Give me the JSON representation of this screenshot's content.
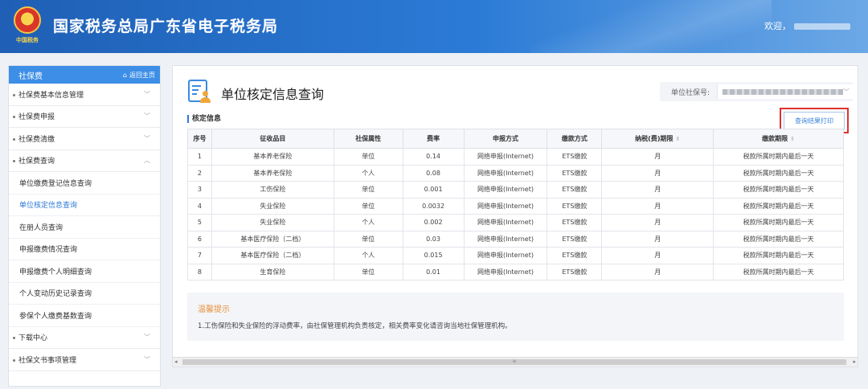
{
  "header": {
    "title": "国家税务总局广东省电子税务局",
    "emblem_caption": "中国税务",
    "welcome": "欢迎，"
  },
  "sidebar": {
    "title": "社保费",
    "home": "返回主页",
    "items": [
      {
        "label": "社保费基本信息管理"
      },
      {
        "label": "社保费申报"
      },
      {
        "label": "社保费清缴"
      },
      {
        "label": "社保费查询"
      }
    ],
    "subitems": [
      {
        "label": "单位缴费登记信息查询"
      },
      {
        "label": "单位核定信息查询"
      },
      {
        "label": "在册人员查询"
      },
      {
        "label": "申报缴费情况查询"
      },
      {
        "label": "申报缴费个人明细查询"
      },
      {
        "label": "个人变动历史记录查询"
      },
      {
        "label": "参保个人缴费基数查询"
      }
    ],
    "bottom_items": [
      {
        "label": "下载中心"
      },
      {
        "label": "社保文书事项管理"
      }
    ]
  },
  "main": {
    "page_title": "单位核定信息查询",
    "unit_label": "单位社保号:",
    "print_button": "查询结果打印",
    "section_title": "核定信息",
    "columns": [
      "序号",
      "征收品目",
      "社保属性",
      "费率",
      "申报方式",
      "缴款方式",
      "纳税(费)期限",
      "缴款期限"
    ],
    "rows": [
      [
        "1",
        "基本养老保险",
        "单位",
        "0.14",
        "网络申报(Internet)",
        "ETS缴款",
        "月",
        "税款所属时期内最后一天"
      ],
      [
        "2",
        "基本养老保险",
        "个人",
        "0.08",
        "网络申报(Internet)",
        "ETS缴款",
        "月",
        "税款所属时期内最后一天"
      ],
      [
        "3",
        "工伤保险",
        "单位",
        "0.001",
        "网络申报(Internet)",
        "ETS缴款",
        "月",
        "税款所属时期内最后一天"
      ],
      [
        "4",
        "失业保险",
        "单位",
        "0.0032",
        "网络申报(Internet)",
        "ETS缴款",
        "月",
        "税款所属时期内最后一天"
      ],
      [
        "5",
        "失业保险",
        "个人",
        "0.002",
        "网络申报(Internet)",
        "ETS缴款",
        "月",
        "税款所属时期内最后一天"
      ],
      [
        "6",
        "基本医疗保险（二档）",
        "单位",
        "0.03",
        "网络申报(Internet)",
        "ETS缴款",
        "月",
        "税款所属时期内最后一天"
      ],
      [
        "7",
        "基本医疗保险（二档）",
        "个人",
        "0.015",
        "网络申报(Internet)",
        "ETS缴款",
        "月",
        "税款所属时期内最后一天"
      ],
      [
        "8",
        "生育保险",
        "单位",
        "0.01",
        "网络申报(Internet)",
        "ETS缴款",
        "月",
        "税款所属时期内最后一天"
      ]
    ],
    "tips_title": "温馨提示",
    "tips_content": "1.工伤保险和失业保险的浮动费率，由社保管理机构负责核定，相关费率变化请咨询当地社保管理机构。"
  },
  "colors": {
    "header_blue": "#2b7bd6",
    "accent_blue": "#3d8ee6",
    "highlight_red": "#e0312f",
    "tips_orange": "#e8913a"
  },
  "icons": [
    "home-icon",
    "chevron-down-icon",
    "chevron-up-icon",
    "sort-icon",
    "dropdown-icon",
    "national-emblem-icon",
    "document-person-icon"
  ]
}
